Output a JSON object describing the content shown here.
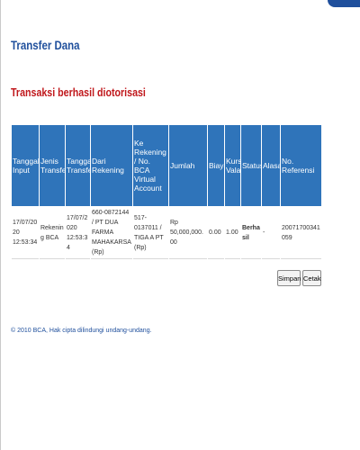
{
  "page": {
    "title": "Transfer Dana",
    "message": "Transaksi berhasil diotorisasi",
    "accent_color": "#1f4f9c",
    "table_header_color": "#2f74ba",
    "success_color": "#c0181c"
  },
  "table": {
    "headers": [
      "Tanggal Input",
      "Jenis Transfer",
      "Tanggal Transfer",
      "Dari Rekening",
      "Ke Rekening / No. BCA Virtual Account",
      "Jumlah",
      "Biaya",
      "Kurs Valas",
      "Status",
      "Alasan",
      "No. Referensi"
    ],
    "rows": [
      {
        "tanggal_input": "17/07/2020 12:53:34",
        "jenis_transfer": "Rekening BCA",
        "tanggal_transfer": "17/07/2020 12:53:34",
        "dari_rekening": "660-0872144 / PT DUA FARMA MAHAKARSA (Rp)",
        "ke_rekening": "517-0137011 / TIGA A PT (Rp)",
        "jumlah": "Rp 50,000,000.00",
        "biaya": "0.00",
        "kurs_valas": "1.00",
        "status": "Berhasil",
        "alasan": "-",
        "no_referensi": "2007170034105​9"
      }
    ]
  },
  "buttons": {
    "save_label": "Simpan",
    "print_label": "Cetak"
  },
  "footer": {
    "copyright": "© 2010 BCA, Hak cipta dilindungi undang-undang."
  }
}
